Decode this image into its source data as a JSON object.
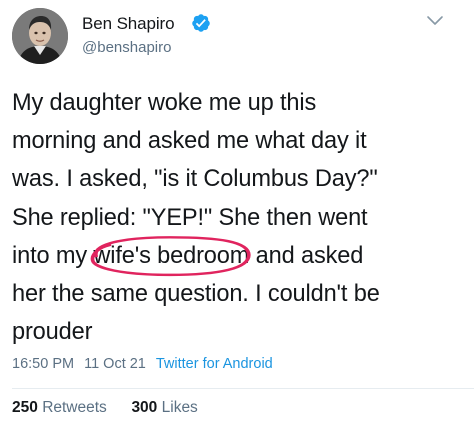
{
  "author": {
    "name": "Ben Shapiro",
    "handle": "@benshapiro",
    "verified": true,
    "avatar_icon": "profile-photo"
  },
  "tweet": {
    "lines": [
      {
        "pre": "My daughter woke me up this"
      },
      {
        "pre": "morning and asked me what day it"
      },
      {
        "pre": "was. I asked, \"is it Columbus Day?\""
      },
      {
        "pre": "She replied: \"YEP!\" She then went"
      },
      {
        "pre": "into my ",
        "circled": "wife's bedroom",
        "post": " and asked"
      },
      {
        "pre": "her the same question. I couldn't be"
      },
      {
        "pre": "prouder"
      }
    ],
    "circle_color": "#e0245e"
  },
  "meta": {
    "time": "16:50 PM",
    "date": "11 Oct 21",
    "source": "Twitter for Android"
  },
  "stats": {
    "retweets_count": "250",
    "retweets_label": "Retweets",
    "likes_count": "300",
    "likes_label": "Likes"
  },
  "colors": {
    "verified": "#1da1f2",
    "secondary_text": "#5b7083",
    "link": "#1b95e0"
  },
  "icons": {
    "verified": "verified-badge-icon",
    "menu": "chevron-down-icon"
  }
}
